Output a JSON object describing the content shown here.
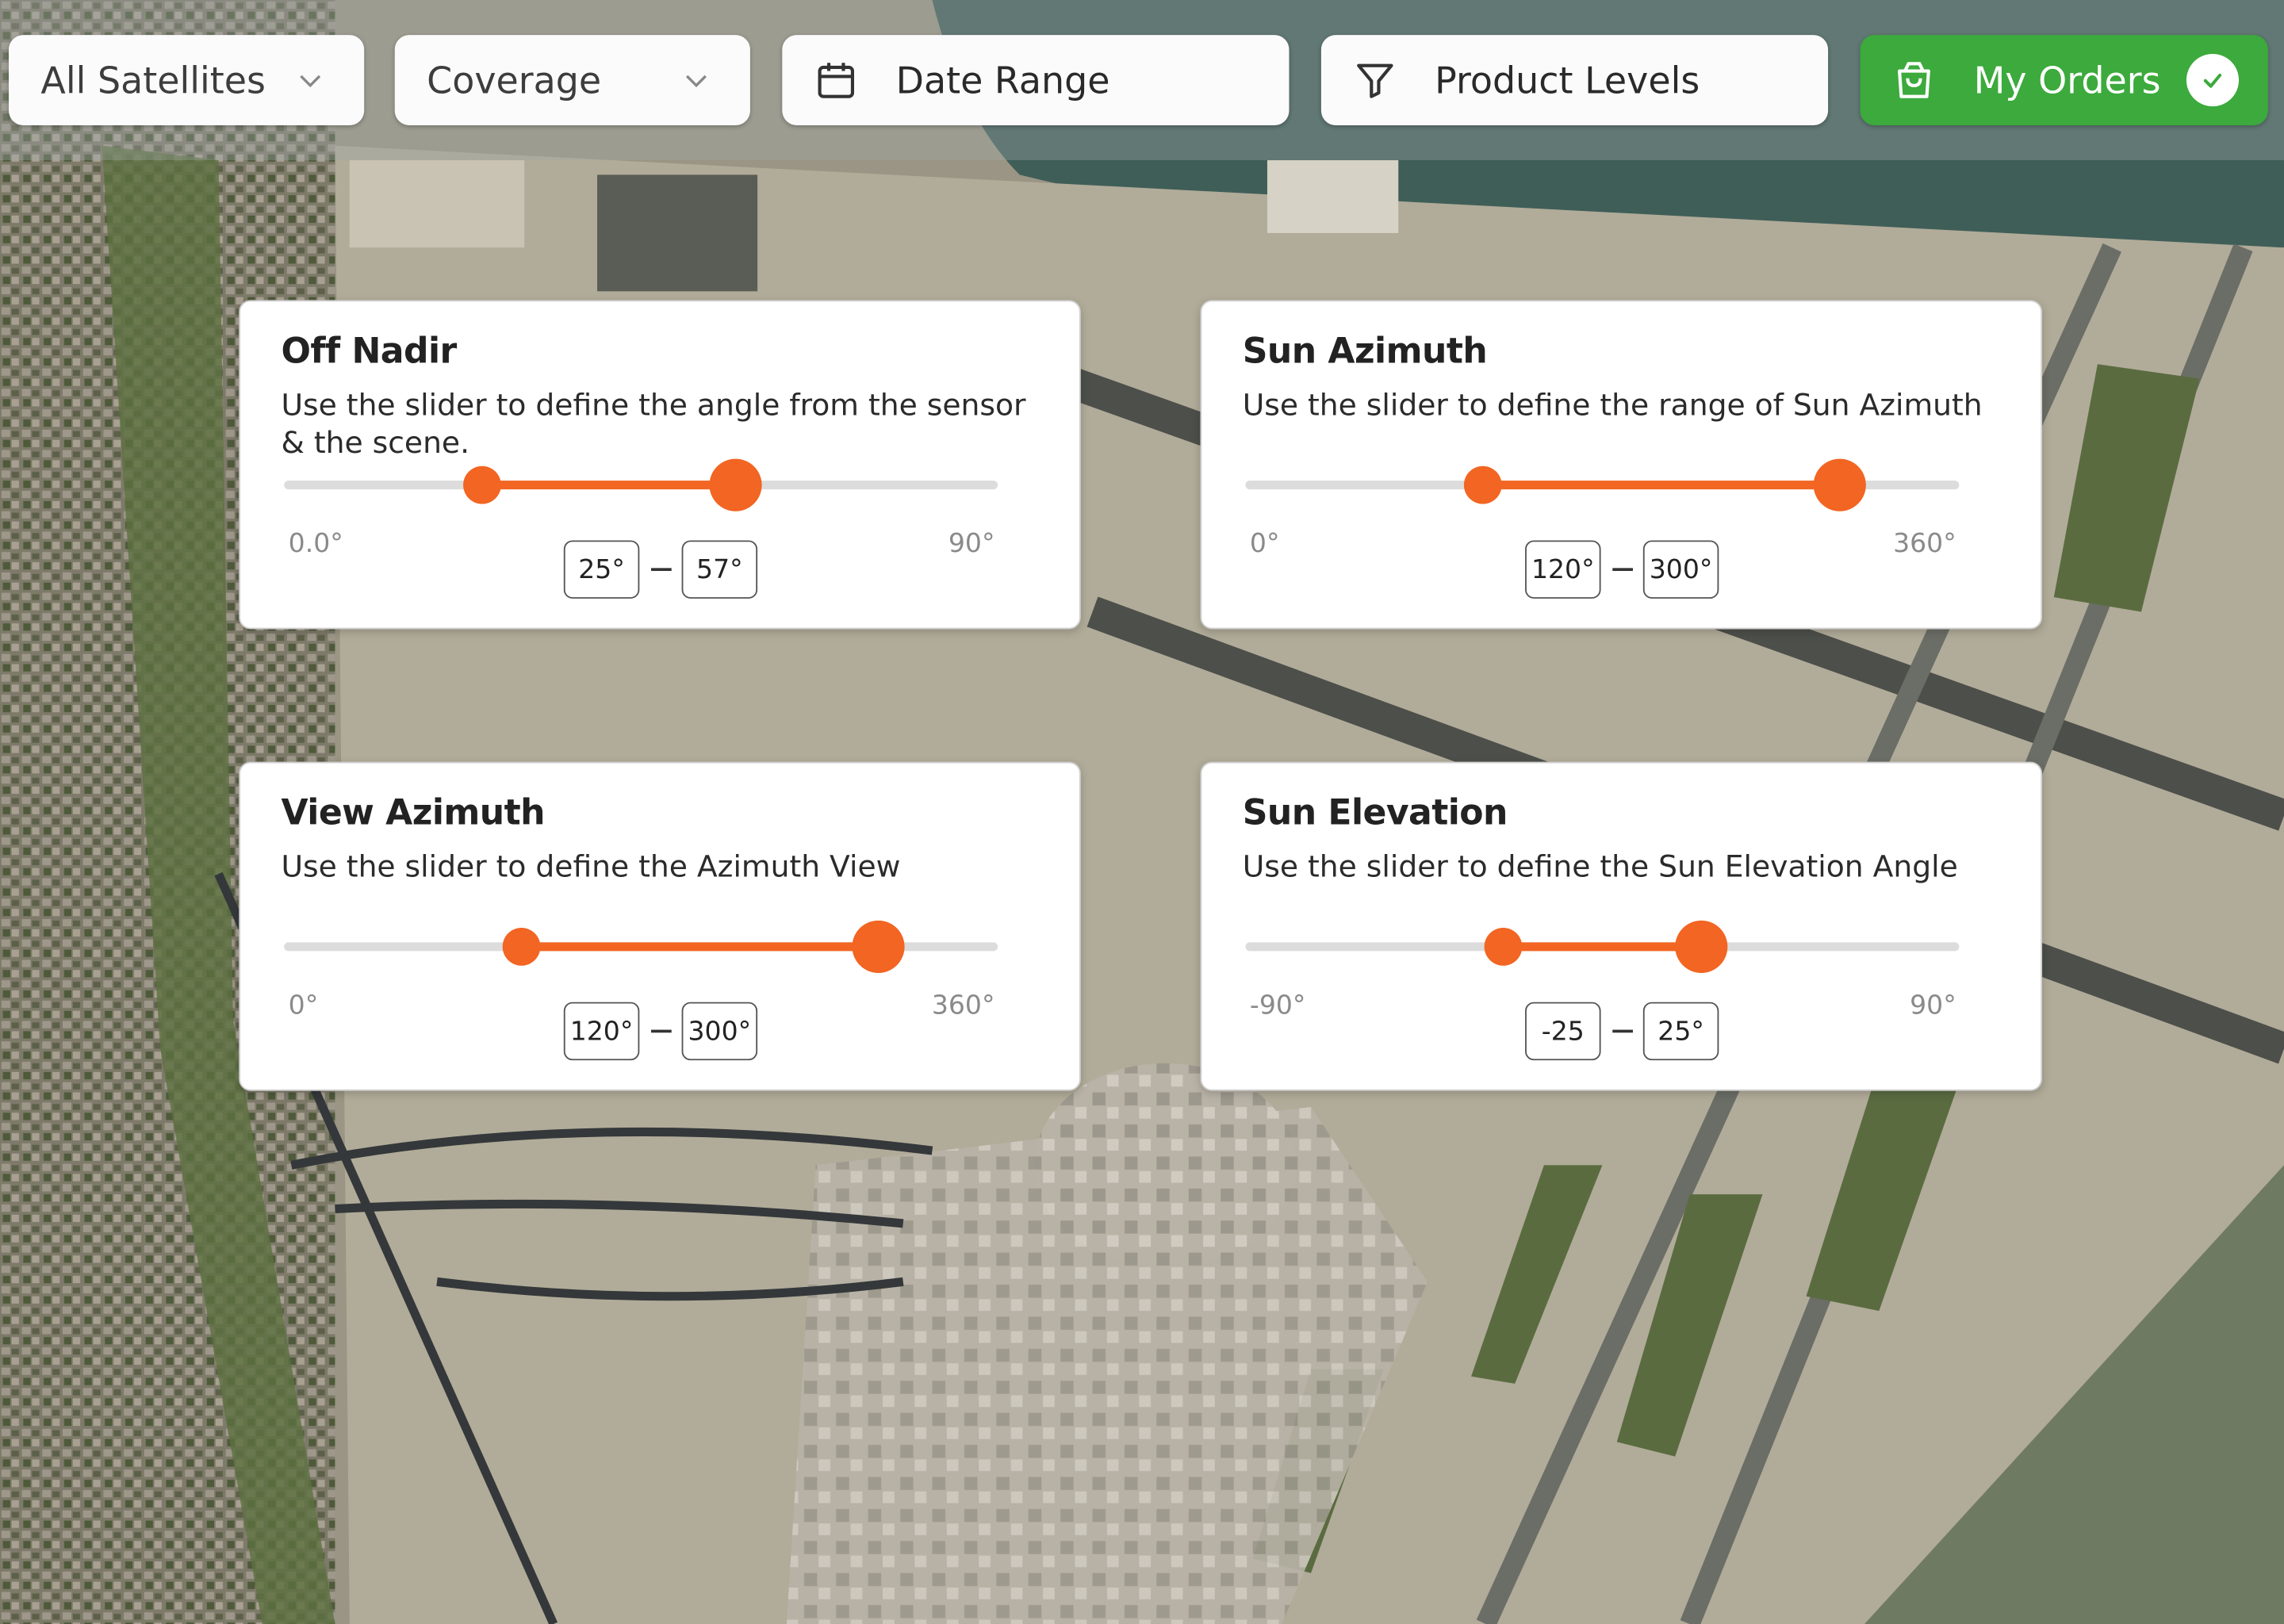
{
  "toolbar": {
    "satellites_label": "All Satellites",
    "coverage_label": "Coverage",
    "date_range_label": "Date Range",
    "product_levels_label": "Product Levels",
    "my_orders_label": "My Orders"
  },
  "panels": {
    "off_nadir": {
      "title": "Off Nadir",
      "description": "Use the slider to define the angle from the sensor & the scene.",
      "min_label": "0.0°",
      "max_label": "90°",
      "low_label": "25°",
      "high_label": "57°",
      "low": 25,
      "high": 57,
      "min": 0,
      "max": 90
    },
    "sun_azimuth": {
      "title": "Sun Azimuth",
      "description": "Use the slider to define the range of Sun Azimuth",
      "min_label": "0°",
      "max_label": "360°",
      "low_label": "120°",
      "high_label": "300°",
      "low": 120,
      "high": 300,
      "min": 0,
      "max": 360
    },
    "view_azimuth": {
      "title": "View Azimuth",
      "description": "Use the slider to define the Azimuth View",
      "min_label": "0°",
      "max_label": "360°",
      "low_label": "120°",
      "high_label": "300°",
      "low": 120,
      "high": 300,
      "min": 0,
      "max": 360
    },
    "sun_elevation": {
      "title": "Sun Elevation",
      "description": "Use the slider to define the Sun Elevation Angle",
      "min_label": "-90°",
      "max_label": "90°",
      "low_label": "-25",
      "high_label": "25°",
      "low": -25,
      "high": 25,
      "min": -90,
      "max": 90
    }
  },
  "colors": {
    "accent_orange": "#f26522",
    "orders_green": "#3caa3c"
  },
  "icons": [
    "chevron-down-icon",
    "calendar-icon",
    "filter-icon",
    "shopping-bag-icon",
    "check-icon"
  ]
}
